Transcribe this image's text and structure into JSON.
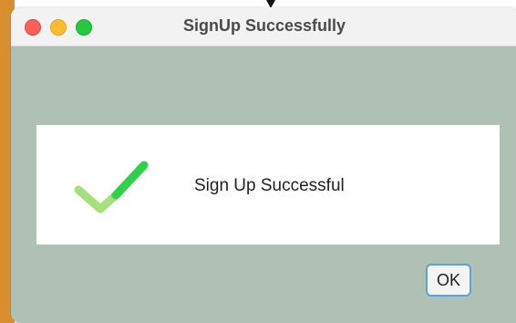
{
  "window": {
    "title": "SignUp Successfully",
    "controls": [
      "close",
      "minimize",
      "maximize"
    ]
  },
  "dialog": {
    "icon": "checkmark-icon",
    "message": "Sign Up Successful",
    "ok_label": "OK"
  },
  "colors": {
    "background": "#afc0b4",
    "check_light": "#a6e07c",
    "check_dark": "#2fd04a",
    "close": "#fe5f57",
    "minimize": "#febc2e",
    "maximize": "#28c840",
    "button_border": "#5aa5d8"
  }
}
